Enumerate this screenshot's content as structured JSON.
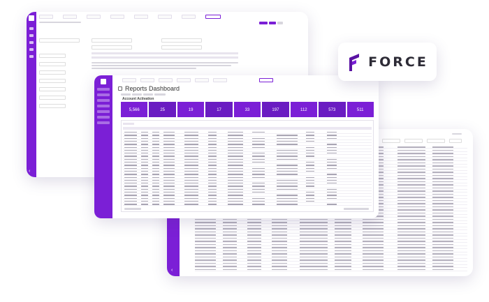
{
  "brand": {
    "name": "FORCE",
    "primary_color": "#7b1fd6",
    "dark_color": "#5a13a3"
  },
  "dashboard": {
    "title": "Reports Dashboard",
    "section": "Account Activation",
    "tiles": [
      {
        "value": "5,566"
      },
      {
        "value": "25"
      },
      {
        "value": "19"
      },
      {
        "value": "17"
      },
      {
        "value": "33"
      },
      {
        "value": "197"
      },
      {
        "value": "112"
      },
      {
        "value": "573"
      },
      {
        "value": "511"
      }
    ]
  },
  "icons": [
    "force-logo-icon",
    "menu-icon",
    "grid-icon",
    "settings-icon",
    "chevron-left-icon"
  ]
}
